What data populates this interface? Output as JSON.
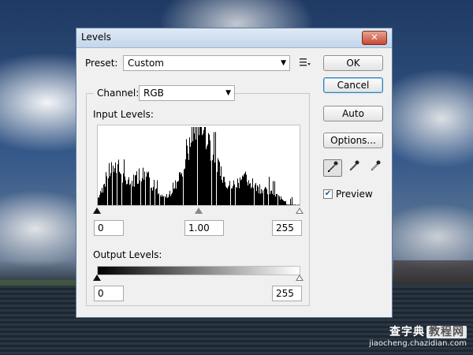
{
  "window": {
    "title": "Levels",
    "close_symbol": "✕"
  },
  "preset": {
    "label": "Preset:",
    "value": "Custom"
  },
  "channel": {
    "label": "Channel:",
    "value": "RGB"
  },
  "input_levels": {
    "label": "Input Levels:",
    "black": "0",
    "gamma": "1.00",
    "white": "255"
  },
  "output_levels": {
    "label": "Output Levels:",
    "black": "0",
    "white": "255"
  },
  "buttons": {
    "ok": "OK",
    "cancel": "Cancel",
    "auto": "Auto",
    "options": "Options..."
  },
  "preview": {
    "label": "Preview",
    "checked": true
  },
  "icons": {
    "preset_menu": "preset-options-icon",
    "eyedroppers": [
      "black-point-eyedropper-icon",
      "gray-point-eyedropper-icon",
      "white-point-eyedropper-icon"
    ]
  },
  "watermark": {
    "line1_a": "查字典",
    "line1_b": "教程网",
    "url": "jiaocheng.chazidian.com"
  },
  "colors": {
    "titlebar": "#c4d6ec",
    "dialog_bg": "#f0f0f0",
    "default_button_border": "#3c7fb1",
    "close_button": "#c74a33"
  }
}
